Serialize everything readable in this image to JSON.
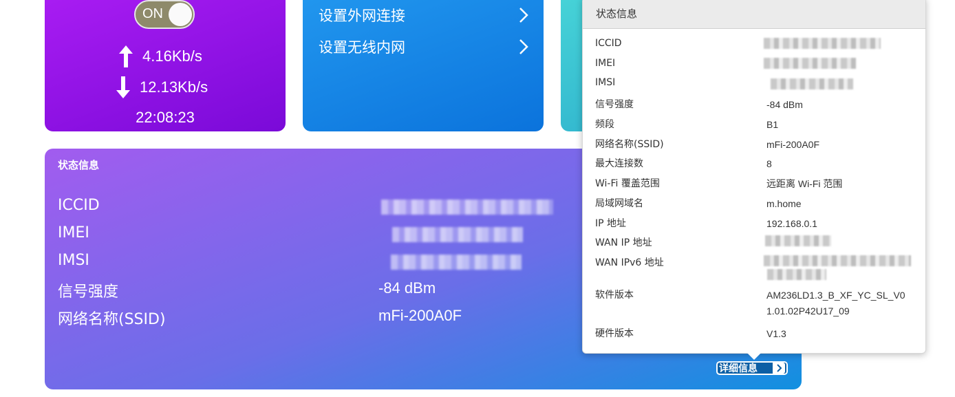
{
  "speed_card": {
    "toggle_label": "ON",
    "upload": "4.16Kb/s",
    "download": "12.13Kb/s",
    "time": "22:08:23"
  },
  "network_card": {
    "items": [
      {
        "label": "设置外网连接"
      },
      {
        "label": "设置无线内网"
      }
    ]
  },
  "status_card": {
    "title": "状态信息",
    "rows": [
      {
        "key": "ICCID",
        "value": ""
      },
      {
        "key": "IMEI",
        "value": ""
      },
      {
        "key": "IMSI",
        "value": ""
      },
      {
        "key": "信号强度",
        "value": "-84 dBm"
      },
      {
        "key": "网络名称(SSID)",
        "value": "mFi-200A0F"
      }
    ],
    "detail_button": "详细信息"
  },
  "popup": {
    "title": "状态信息",
    "rows": [
      {
        "key": "ICCID",
        "value": ""
      },
      {
        "key": "IMEI",
        "value": ""
      },
      {
        "key": "IMSI",
        "value": ""
      },
      {
        "key": "信号强度",
        "value": "-84 dBm"
      },
      {
        "key": "频段",
        "value": "B1"
      },
      {
        "key": "网络名称(SSID)",
        "value": "mFi-200A0F"
      },
      {
        "key": "最大连接数",
        "value": "8"
      },
      {
        "key": "Wi-Fi 覆盖范围",
        "value": "远距离 Wi-Fi 范围"
      },
      {
        "key": "局域网域名",
        "value": "m.home"
      },
      {
        "key": "IP 地址",
        "value": "192.168.0.1"
      },
      {
        "key": "WAN IP 地址",
        "value": ""
      },
      {
        "key": "WAN IPv6 地址",
        "value": ""
      },
      {
        "key": "软件版本",
        "value": "AM236LD1.3_B_XF_YC_SL_V01.01.02P42U17_09"
      },
      {
        "key": "硬件版本",
        "value": "V1.3"
      }
    ]
  },
  "colors": {
    "speed_card": "#8e12e6",
    "network_card": "#1583e4",
    "teal_card": "#3fc7d4",
    "status_card_start": "#a25cef",
    "status_card_end": "#1190e0"
  }
}
